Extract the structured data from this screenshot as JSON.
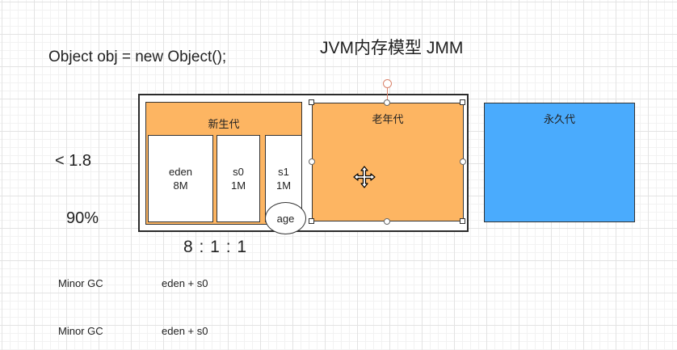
{
  "header": {
    "code_line": "Object obj = new Object();",
    "title": "JVM内存模型 JMM"
  },
  "notes": {
    "version": "< 1.8",
    "percent": "90%",
    "ratio": "8 : 1 : 1"
  },
  "diagram": {
    "young_gen": "新生代",
    "eden": {
      "name": "eden",
      "size": "8M"
    },
    "s0": {
      "name": "s0",
      "size": "1M"
    },
    "s1": {
      "name": "s1",
      "size": "1M"
    },
    "age": "age",
    "old_gen": "老年代",
    "perm_gen": "永久代",
    "colors": {
      "generation_fill": "#fdb562",
      "perm_fill": "#4aabfd",
      "border": "#333333"
    }
  },
  "gc_rows": [
    {
      "label": "Minor GC",
      "value": "eden + s0"
    },
    {
      "label": "Minor GC",
      "value": "eden + s0"
    }
  ]
}
